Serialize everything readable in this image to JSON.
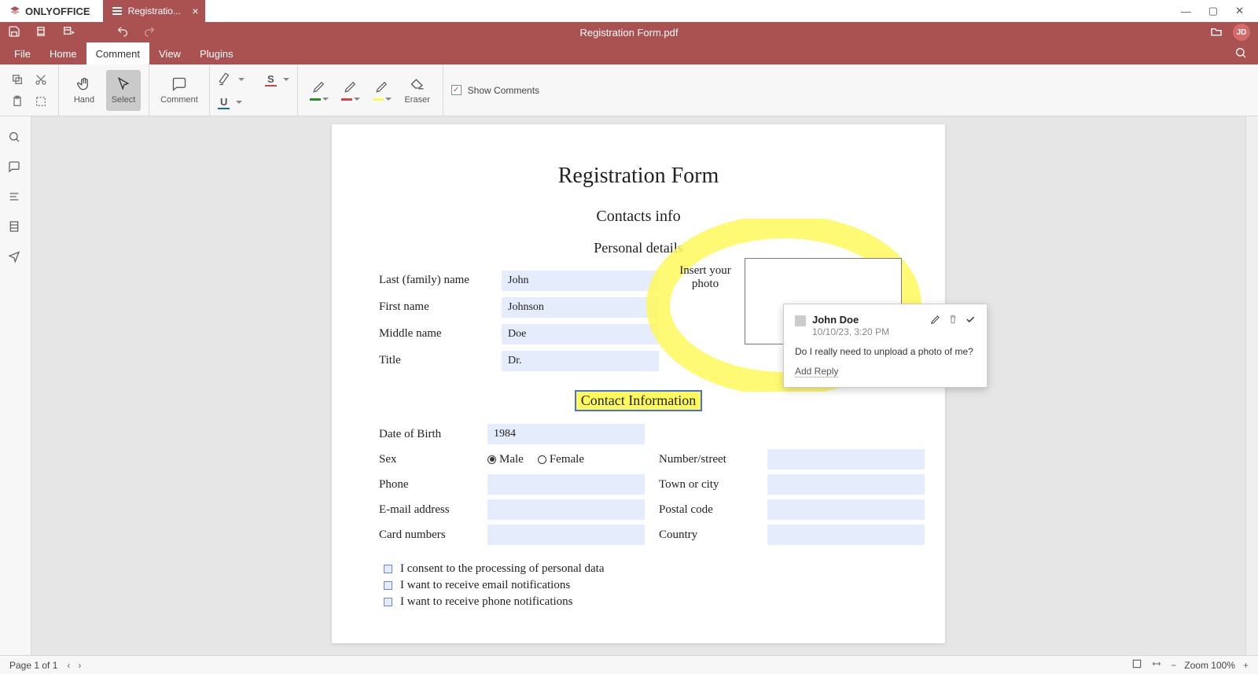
{
  "app": {
    "name": "ONLYOFFICE",
    "tab_title": "Registratio...",
    "doc_title": "Registration Form.pdf",
    "avatar_initials": "JD"
  },
  "menus": {
    "file": "File",
    "home": "Home",
    "comment": "Comment",
    "view": "View",
    "plugins": "Plugins"
  },
  "ribbon": {
    "hand": "Hand",
    "select": "Select",
    "comment": "Comment",
    "eraser": "Eraser",
    "show_comments": "Show Comments",
    "show_comments_checked": true,
    "colors": {
      "highlight": "#fff95b",
      "strike": "#d64545",
      "underline": "#1565c0",
      "pen_green": "#2e8b2e",
      "pen_red": "#d64545",
      "pen_yellow": "#fff95b"
    }
  },
  "form": {
    "title": "Registration Form",
    "subtitle": "Contacts info",
    "section_personal": "Personal details",
    "labels": {
      "last_name": "Last (family) name",
      "first_name": "First name",
      "middle_name": "Middle name",
      "title": "Title",
      "insert_photo": "Insert your photo",
      "dob": "Date of Birth",
      "sex": "Sex",
      "phone": "Phone",
      "email": "E-mail address",
      "cards": "Card numbers",
      "number_street": "Number/street",
      "town": "Town or city",
      "postal": "Postal code",
      "country": "Country",
      "male": "Male",
      "female": "Female"
    },
    "values": {
      "last_name": "John",
      "first_name": "Johnson",
      "middle_name": "Doe",
      "title": "Dr.",
      "dob": "1984",
      "sex": "male"
    },
    "contact_header": "Contact Information",
    "consents": [
      "I consent to the processing of personal data",
      "I want to receive email notifications",
      "I want to receive phone notifications"
    ]
  },
  "comment": {
    "user": "John Doe",
    "date": "10/10/23, 3:20 PM",
    "text": "Do I really need to unpload a photo of me?",
    "reply_label": "Add Reply"
  },
  "status": {
    "page_label": "Page 1 of 1",
    "zoom_label": "Zoom 100%"
  }
}
